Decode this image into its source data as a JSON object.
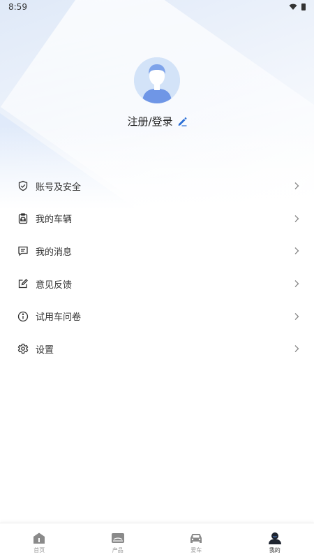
{
  "status_bar": {
    "time": "8:59"
  },
  "profile": {
    "login_label": "注册/登录"
  },
  "menu": {
    "items": [
      {
        "label": "账号及安全",
        "icon": "shield-check-icon"
      },
      {
        "label": "我的车辆",
        "icon": "vehicle-icon"
      },
      {
        "label": "我的消息",
        "icon": "message-icon"
      },
      {
        "label": "意见反馈",
        "icon": "edit-feedback-icon"
      },
      {
        "label": "试用车问卷",
        "icon": "info-icon"
      },
      {
        "label": "设置",
        "icon": "gear-icon"
      }
    ]
  },
  "tabbar": {
    "tabs": [
      {
        "label": "首页",
        "icon": "home-icon",
        "active": false
      },
      {
        "label": "产品",
        "icon": "product-icon",
        "active": false
      },
      {
        "label": "爱车",
        "icon": "car-icon",
        "active": false
      },
      {
        "label": "我的",
        "icon": "user-icon",
        "active": true
      }
    ]
  },
  "colors": {
    "accent": "#2b6fd6",
    "avatar_bg": "#cfe0f7"
  }
}
